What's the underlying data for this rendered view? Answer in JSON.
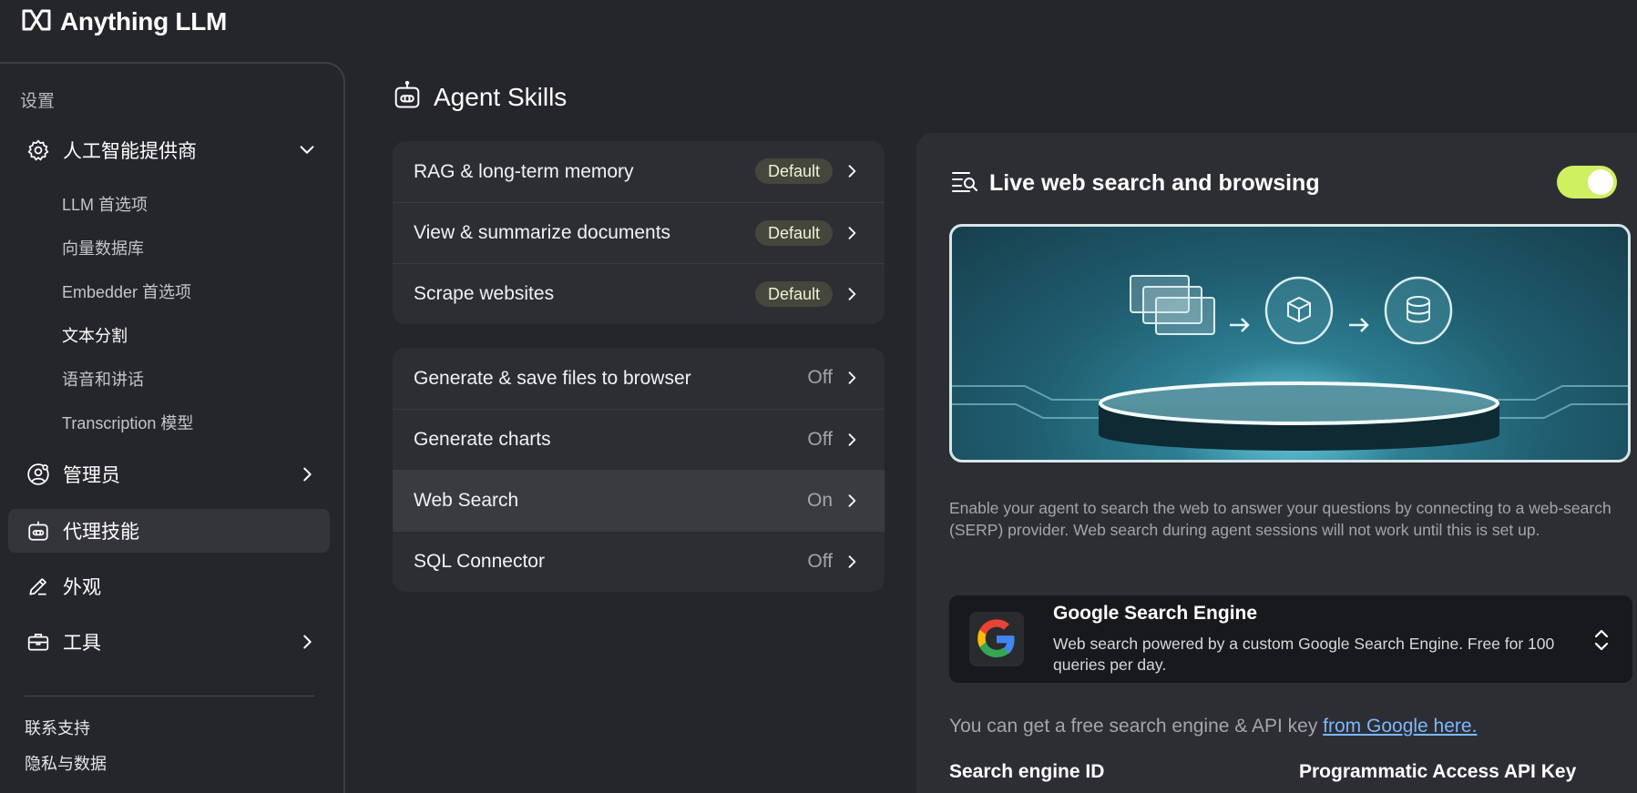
{
  "app": {
    "name": "Anything LLM"
  },
  "sidebar": {
    "heading": "设置",
    "ai_providers": {
      "label": "人工智能提供商",
      "subitems": [
        {
          "label": "LLM 首选项"
        },
        {
          "label": "向量数据库"
        },
        {
          "label": "Embedder 首选项"
        },
        {
          "label": "文本分割"
        },
        {
          "label": "语音和讲话"
        },
        {
          "label": "Transcription 模型"
        }
      ]
    },
    "admin": {
      "label": "管理员"
    },
    "agent_skills": {
      "label": "代理技能"
    },
    "appearance": {
      "label": "外观"
    },
    "tools": {
      "label": "工具"
    },
    "footer": [
      {
        "label": "联系支持"
      },
      {
        "label": "隐私与数据"
      }
    ]
  },
  "main": {
    "title": "Agent Skills",
    "default_skills": [
      {
        "name": "RAG & long-term memory",
        "status": "Default"
      },
      {
        "name": "View & summarize documents",
        "status": "Default"
      },
      {
        "name": "Scrape websites",
        "status": "Default"
      }
    ],
    "configurable_skills": [
      {
        "name": "Generate & save files to browser",
        "status": "Off"
      },
      {
        "name": "Generate charts",
        "status": "Off"
      },
      {
        "name": "Web Search",
        "status": "On"
      },
      {
        "name": "SQL Connector",
        "status": "Off"
      }
    ]
  },
  "panel": {
    "title": "Live web search and browsing",
    "enabled": true,
    "description": "Enable your agent to search the web to answer your questions by connecting to a web-search (SERP) provider. Web search during agent sessions will not work until this is set up.",
    "provider": {
      "name": "Google Search Engine",
      "description": "Web search powered by a custom Google Search Engine. Free for 100 queries per day."
    },
    "api_hint_prefix": "You can get a free search engine & API key ",
    "api_hint_link": "from Google here.",
    "fields": {
      "engine_id_label": "Search engine ID",
      "api_key_label": "Programmatic Access API Key"
    }
  },
  "colors": {
    "background": "#25262b",
    "card": "#2d2e33",
    "toggle_on": "#cef061",
    "link": "#7ab8ff"
  }
}
